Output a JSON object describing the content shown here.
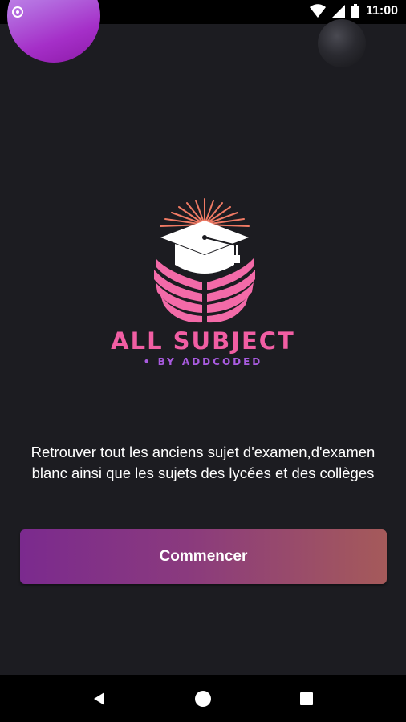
{
  "status_bar": {
    "time": "11:00",
    "icons": [
      "notification-dot-icon",
      "wifi-icon",
      "signal-icon",
      "battery-icon"
    ]
  },
  "logo": {
    "title": "ALL SUBJECT",
    "subtitle": "• BY ADDCODED",
    "icon": "graduation-cap-book-icon",
    "colors": {
      "primary": "#f15ea3",
      "secondary": "#a95be0",
      "cap": "#ffffff"
    }
  },
  "main": {
    "description_line1": "Retrouver tout les anciens sujet d'examen,d'examen",
    "description_line2": "blanc ainsi que les sujets des lycées et des collèges",
    "start_button_label": "Commencer"
  },
  "nav_bar": {
    "icons": [
      "back-icon",
      "home-icon",
      "recents-icon"
    ]
  },
  "theme": {
    "background": "#1c1c21",
    "button_gradient_start": "#7b2a8e",
    "button_gradient_end": "#a55a5a"
  }
}
